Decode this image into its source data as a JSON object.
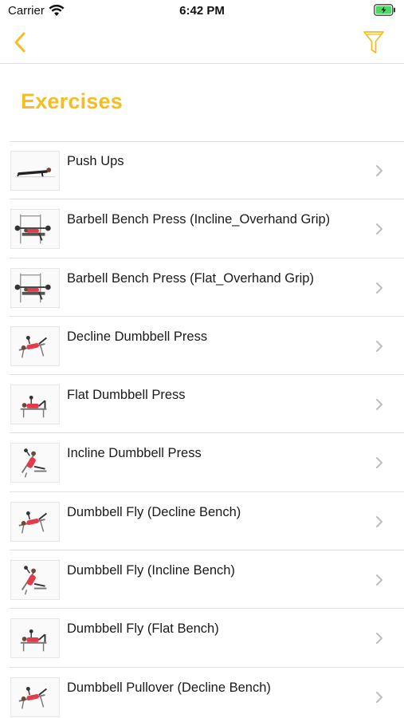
{
  "status_bar": {
    "carrier": "Carrier",
    "time": "6:42 PM",
    "battery_color": "#4cd964"
  },
  "nav": {
    "accent_color": "#f5bd1f",
    "back_icon": "chevron-left-icon",
    "filter_icon": "funnel-icon"
  },
  "page": {
    "title": "Exercises"
  },
  "exercises": [
    {
      "label": "Push Ups",
      "thumb": "pushup"
    },
    {
      "label": "Barbell Bench Press (Incline_Overhand Grip)",
      "thumb": "barbell"
    },
    {
      "label": "Barbell Bench Press (Flat_Overhand Grip)",
      "thumb": "barbell"
    },
    {
      "label": "Decline Dumbbell Press",
      "thumb": "decline"
    },
    {
      "label": "Flat Dumbbell Press",
      "thumb": "flat"
    },
    {
      "label": "Incline Dumbbell Press",
      "thumb": "incline"
    },
    {
      "label": "Dumbbell Fly (Decline Bench)",
      "thumb": "decline"
    },
    {
      "label": "Dumbbell Fly (Incline Bench)",
      "thumb": "incline"
    },
    {
      "label": "Dumbbell Fly (Flat Bench)",
      "thumb": "flat"
    },
    {
      "label": "Dumbbell Pullover (Decline Bench)",
      "thumb": "decline"
    }
  ]
}
